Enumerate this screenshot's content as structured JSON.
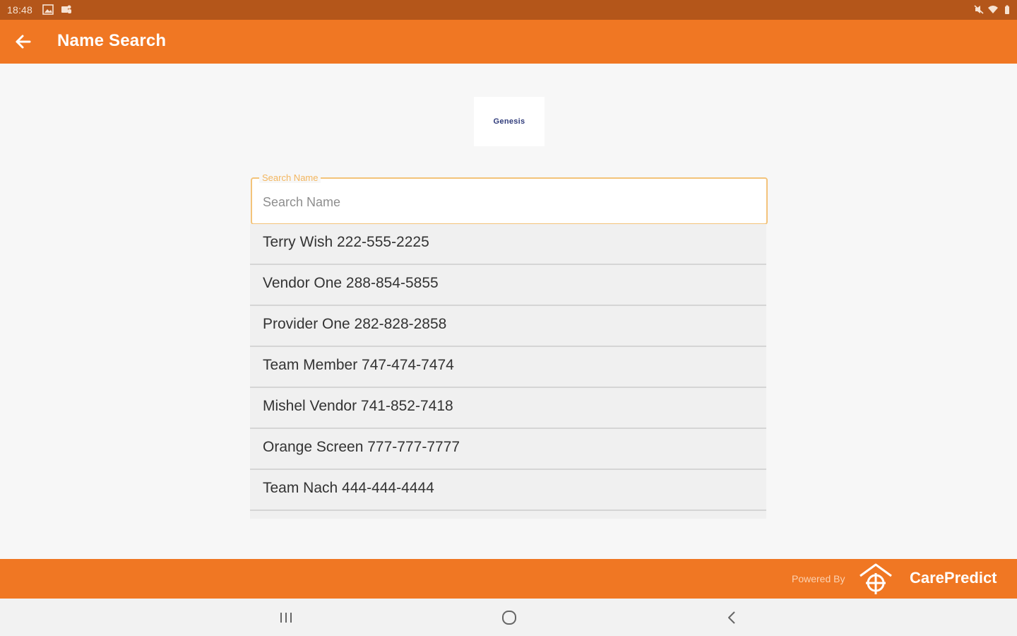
{
  "status_bar": {
    "time": "18:48",
    "icons": [
      "gallery-icon",
      "teams-icon",
      "mute-icon",
      "wifi-icon",
      "battery-icon"
    ]
  },
  "app_bar": {
    "title": "Name Search",
    "back_icon": "arrow-left-icon"
  },
  "logo": {
    "text": "Genesis"
  },
  "search": {
    "label": "Search Name",
    "placeholder": "Search Name",
    "value": ""
  },
  "results": [
    "Terry Wish 222-555-2225",
    "Vendor One 288-854-5855",
    "Provider One 282-828-2858",
    "Team Member 747-474-7474",
    "Mishel Vendor 741-852-7418",
    "Orange Screen 777-777-7777",
    "Team Nach 444-444-4444",
    ""
  ],
  "footer": {
    "powered_by": "Powered By",
    "brand": "CarePredict"
  },
  "nav_bar": {
    "icons": [
      "recents-icon",
      "home-icon",
      "back-icon"
    ]
  },
  "colors": {
    "status_bar": "#b4561a",
    "accent": "#f07723",
    "field_outline": "#f3c37a"
  }
}
